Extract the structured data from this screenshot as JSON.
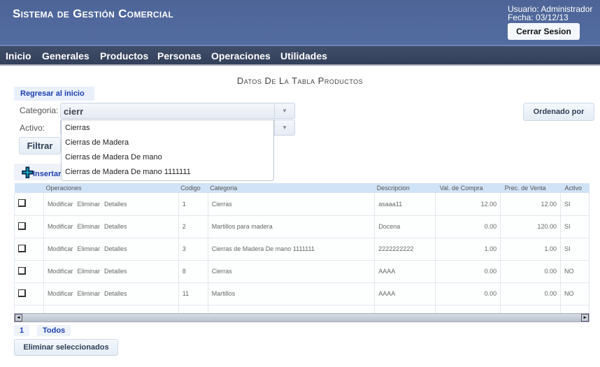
{
  "header": {
    "title": "Sistema de Gestión Comercial",
    "user": "Usuario: Administrador",
    "date": "Fecha: 03/12/13",
    "logout": "Cerrar Sesion"
  },
  "nav": [
    "Inicio",
    "Generales",
    "Productos",
    "Personas",
    "Operaciones",
    "Utilidades"
  ],
  "page_title": "Datos De La Tabla Productos",
  "back_link": "Regresar al inicio",
  "filters": {
    "categoria_label": "Categoria:",
    "categoria_value": "cierr",
    "activo_label": "Activo:",
    "filter_button": "Filtrar",
    "order_button": "Ordenado por"
  },
  "dropdown": [
    "Cierras",
    "Cierras de Madera",
    "Cierras de Madera De mano",
    "Cierras de Madera De mano 1111111"
  ],
  "insert": "Insertar",
  "table": {
    "headers": [
      "",
      "Operaciones",
      "Codigo",
      "Categoria",
      "Descripcion",
      "Val. de Compra",
      "Prec. de Venta",
      "Activo"
    ],
    "ops": [
      "Modificar",
      "Eliminar",
      "Detalles"
    ],
    "rows": [
      [
        "1",
        "Cierras",
        "asaaa11",
        "12.00",
        "12.00",
        "SI"
      ],
      [
        "2",
        "Martillos para madera",
        "Docena",
        "0.00",
        "120.00",
        "SI"
      ],
      [
        "3",
        "Cierras de Madera De mano 1111111",
        "2222222222",
        "1.00",
        "1.00",
        "SI"
      ],
      [
        "8",
        "Cierras",
        "AAAA",
        "0.00",
        "0.00",
        "NO"
      ],
      [
        "11",
        "Martillos",
        "AAAA",
        "0.00",
        "0.00",
        "NO"
      ]
    ]
  },
  "pagination": {
    "page": "1",
    "all": "Todos"
  },
  "delete_selected": "Eliminar seleccionados"
}
